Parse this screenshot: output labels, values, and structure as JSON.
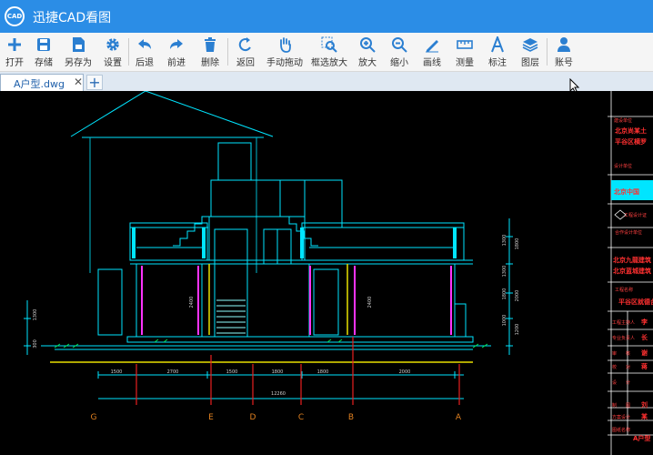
{
  "app": {
    "title": "迅捷CAD看图",
    "logo_text": "CAD"
  },
  "toolbar": {
    "items": [
      {
        "label": "打开",
        "icon": "plus-icon"
      },
      {
        "label": "存储",
        "icon": "save-icon"
      },
      {
        "label": "另存为",
        "icon": "save-as-icon"
      },
      {
        "label": "设置",
        "icon": "gear-icon"
      },
      {
        "label": "后退",
        "icon": "undo-arrow-icon"
      },
      {
        "label": "前进",
        "icon": "redo-arrow-icon"
      },
      {
        "label": "删除",
        "icon": "trash-icon"
      },
      {
        "label": "返回",
        "icon": "return-icon"
      },
      {
        "label": "手动拖动",
        "icon": "hand-icon"
      },
      {
        "label": "框选放大",
        "icon": "box-zoom-icon"
      },
      {
        "label": "放大",
        "icon": "zoom-in-icon"
      },
      {
        "label": "缩小",
        "icon": "zoom-out-icon"
      },
      {
        "label": "画线",
        "icon": "pen-icon"
      },
      {
        "label": "测量",
        "icon": "ruler-icon"
      },
      {
        "label": "标注",
        "icon": "annotate-a-icon"
      },
      {
        "label": "图层",
        "icon": "layers-icon"
      },
      {
        "label": "账号",
        "icon": "user-icon"
      }
    ]
  },
  "tabs": [
    {
      "label": "A户型.dwg",
      "close": "✕"
    }
  ],
  "add_tab": "+",
  "colors": {
    "accent": "#2b8de6",
    "cad_bg": "#000000",
    "cyan": "#00e5ff",
    "magenta": "#ff33ff",
    "red": "#e82020",
    "yellow": "#e8e000"
  },
  "drawing": {
    "dims": [
      "1500",
      "2700",
      "1500",
      "1800",
      "1800",
      "2000"
    ],
    "total_dim": "12260",
    "axes": [
      "G",
      "E",
      "D",
      "C",
      "B",
      "A"
    ],
    "side_dims_left": [
      "1300",
      "300"
    ],
    "room_dim": "2400",
    "right_dims": [
      "1300",
      "1800",
      "1300",
      "2000",
      "1800",
      "1000",
      "1200"
    ],
    "title_block": {
      "row1_label": "建设单位",
      "company1": "北京尚某土",
      "company1b": "平谷区横罗",
      "design_unit_label": "设计单位",
      "company2": "北京中国",
      "cert_label": "工程设计证",
      "partner_label": "合作设计单位",
      "partner1": "北京九龍建筑",
      "partner2": "北京蓝城建筑",
      "project_label": "工程名称",
      "project": "平谷区就德台",
      "r_a": "工程主持人",
      "r_a_v": "李",
      "r_b": "专业负责人",
      "r_b_v": "长",
      "r_c": "审　　核",
      "r_c_v": "谢",
      "r_d": "校　　对",
      "r_d_v": "蒋",
      "r_e": "设　　计",
      "r_f": "制　　图",
      "r_f_v": "刘",
      "r_g": "方案设计",
      "r_g_v": "某",
      "r_h": "图纸名称",
      "r_h_v": "A户型"
    }
  }
}
